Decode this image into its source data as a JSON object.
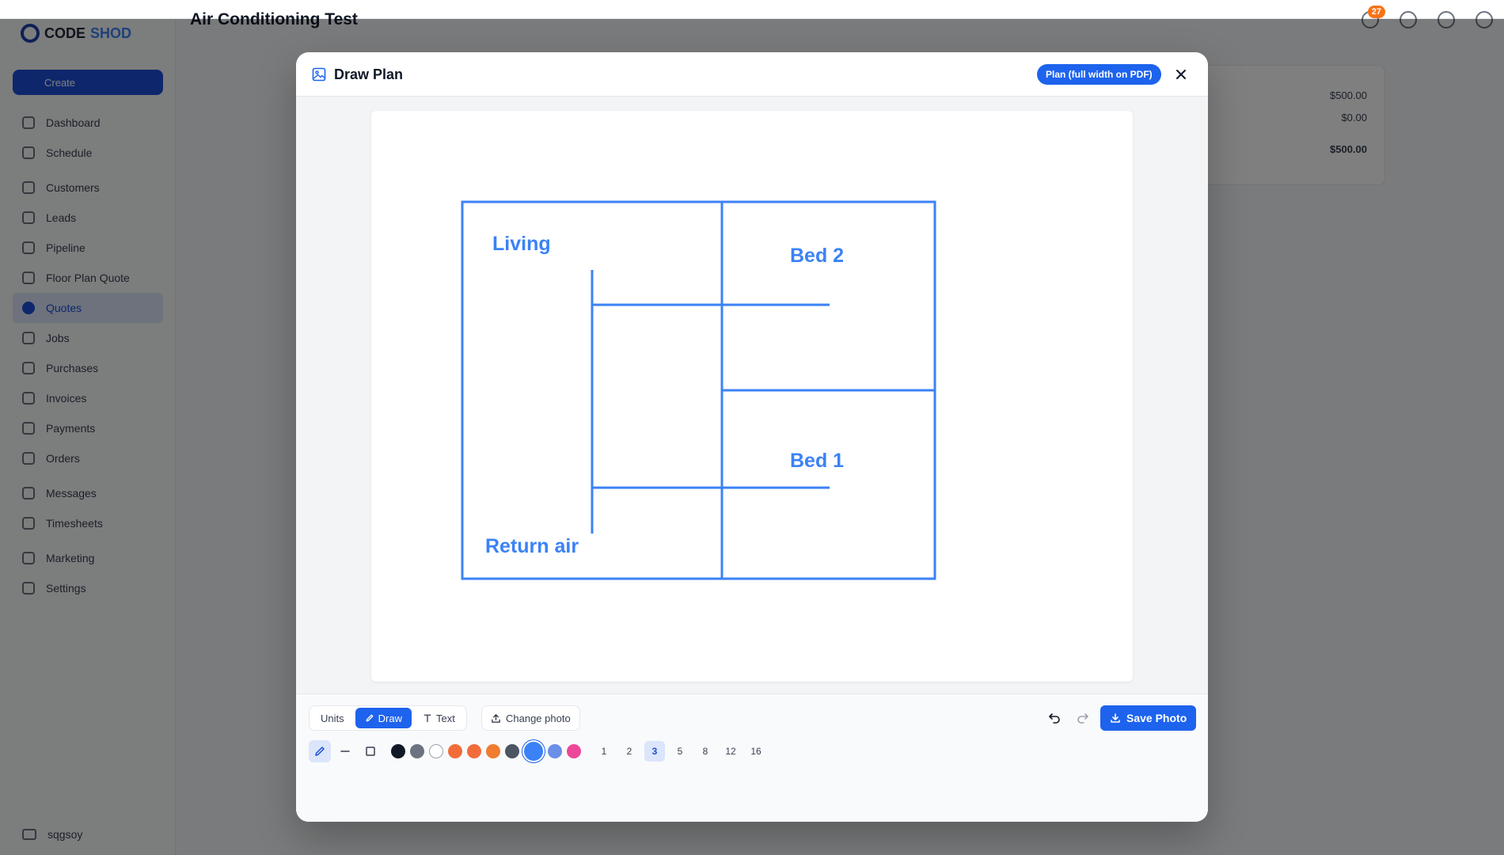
{
  "app": {
    "page_title": "Air Conditioning Test",
    "notification_count": "27",
    "logo": {
      "part1": "CODE",
      "part2": "SHOD"
    },
    "create_label": "Create",
    "nav": [
      "Dashboard",
      "Schedule",
      "Customers",
      "Leads",
      "Pipeline",
      "Floor Plan Quote",
      "Quotes",
      "Jobs",
      "Purchases",
      "Invoices",
      "Payments",
      "Orders",
      "Messages",
      "Timesheets",
      "Marketing",
      "Settings"
    ],
    "active_nav": "Quotes",
    "user": "sqgsoy",
    "summary": {
      "line1": "$500.00",
      "line2": "$0.00",
      "total": "$500.00"
    }
  },
  "modal": {
    "title": "Draw Plan",
    "pdf_chip": "Plan (full width on PDF)",
    "close_icon": "close-icon",
    "plan": {
      "line_color": "#3b82f6",
      "labels": [
        "Living",
        "Bed 2",
        "Bed 1",
        "Return air"
      ]
    },
    "modes": [
      {
        "label": "Units",
        "active": false
      },
      {
        "label": "Draw",
        "active": true,
        "icon": "pencil-icon"
      },
      {
        "label": "Text",
        "active": false,
        "icon": "text-icon"
      }
    ],
    "change_photo": "Change photo",
    "save_label": "Save Photo",
    "tools": [
      "pencil-tool",
      "line-tool",
      "rectangle-tool"
    ],
    "active_tool": "pencil-tool",
    "colors": [
      "#111827",
      "#6b7280",
      "#ffffff",
      "#f26c3a",
      "#f26c3a",
      "#f07c2f",
      "#4b5563",
      "#3b82f6",
      "#6b8fe8",
      "#ec4899"
    ],
    "selected_color_index": 7,
    "sizes": [
      "1",
      "2",
      "3",
      "5",
      "8",
      "12",
      "16"
    ],
    "active_size": "3"
  }
}
